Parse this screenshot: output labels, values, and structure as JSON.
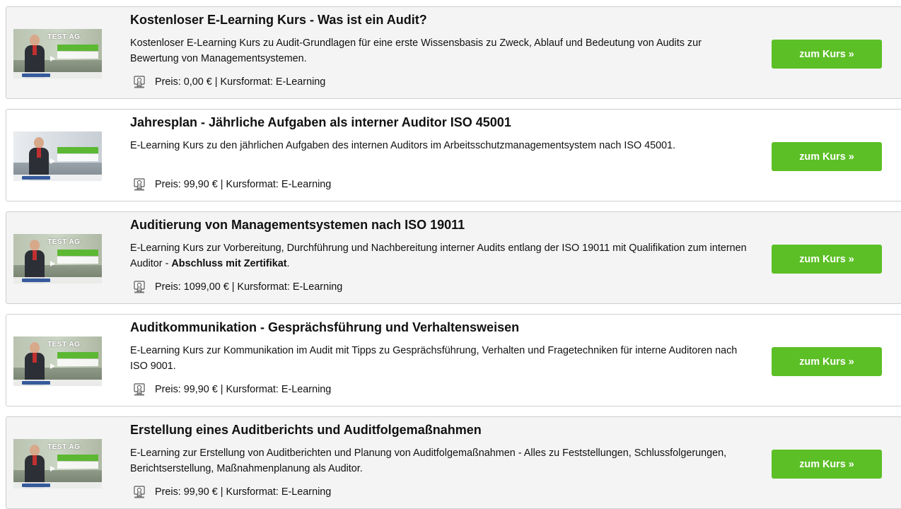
{
  "courses": [
    {
      "title": "Kostenloser E-Learning Kurs - Was ist ein Audit?",
      "description": "Kostenloser E-Learning Kurs zu Audit-Grundlagen für eine erste Wissensbasis zu Zweck, Ablauf und Bedeutung von Audits zur Bewertung von Managementsystemen.",
      "description_bold": "",
      "description_end": "",
      "meta": "Preis: 0,00 € | Kursformat: E-Learning",
      "thumb_logo": "TEST AG",
      "button": "zum Kurs »"
    },
    {
      "title": "Jahresplan - Jährliche Aufgaben als interner Auditor ISO 45001",
      "description": "E-Learning Kurs zu den jährlichen Aufgaben des internen Auditors im Arbeitsschutzmanagementsystem nach ISO 45001.",
      "description_bold": "",
      "description_end": "",
      "meta": "Preis: 99,90 € | Kursformat: E-Learning",
      "thumb_logo": "",
      "button": "zum Kurs »"
    },
    {
      "title": "Auditierung von Managementsystemen nach ISO 19011",
      "description": "E-Learning Kurs zur Vorbereitung, Durchführung und Nachbereitung interner Audits entlang der ISO 19011 mit Qualifikation zum internen Auditor - ",
      "description_bold": "Abschluss mit Zertifikat",
      "description_end": ".",
      "meta": "Preis: 1099,00 € | Kursformat: E-Learning",
      "thumb_logo": "TEST AG",
      "button": "zum Kurs »"
    },
    {
      "title": "Auditkommunikation - Gesprächsführung und Verhaltensweisen",
      "description": "E-Learning Kurs zur Kommunikation im Audit mit Tipps zu Gesprächsführung, Verhalten und Fragetechniken für interne Auditoren nach ISO 9001.",
      "description_bold": "",
      "description_end": "",
      "meta": "Preis: 99,90 € | Kursformat: E-Learning",
      "thumb_logo": "TEST AG",
      "button": "zum Kurs »"
    },
    {
      "title": "Erstellung eines Auditberichts und Auditfolgemaßnahmen",
      "description": "E-Learning zur Erstellung von Auditberichten und Planung von Auditfolgemaßnahmen - Alles zu Feststellungen, Schlussfolgerungen, Berichtserstellung, Maßnahmenplanung als Auditor.",
      "description_bold": "",
      "description_end": "",
      "meta": "Preis: 99,90 € | Kursformat: E-Learning",
      "thumb_logo": "TEST AG",
      "button": "zum Kurs »"
    }
  ],
  "colors": {
    "button_bg": "#5cbf26",
    "card_shaded_bg": "#f4f4f4",
    "card_border": "#cfcfcf"
  },
  "icons": {
    "meta_icon": "certificate-badge-icon",
    "thumb_play": "play-icon"
  }
}
